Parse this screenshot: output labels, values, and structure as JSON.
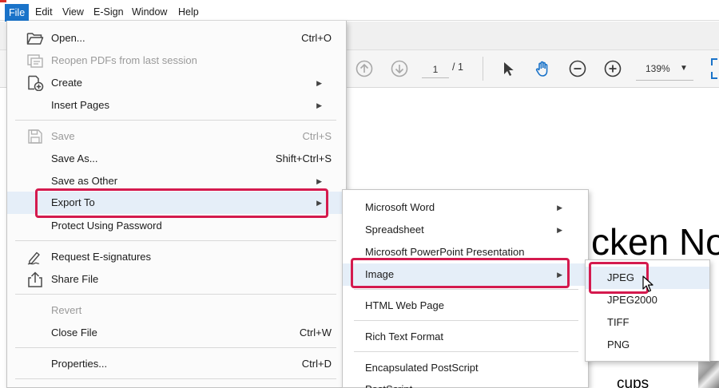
{
  "menubar": {
    "items": [
      "File",
      "Edit",
      "View",
      "E-Sign",
      "Window",
      "Help"
    ]
  },
  "toolbar": {
    "page_current": "1",
    "page_total": "/ 1",
    "zoom": "139%"
  },
  "document": {
    "heading": "cken No",
    "subheading": "cups"
  },
  "file_menu": {
    "items": [
      {
        "label": "Open...",
        "shortcut": "Ctrl+O",
        "icon": "open-folder-icon"
      },
      {
        "label": "Reopen PDFs from last session",
        "icon": "reopen-icon"
      },
      {
        "label": "Create",
        "icon": "create-icon"
      },
      {
        "label": "Insert Pages"
      },
      {
        "label": "Save",
        "shortcut": "Ctrl+S",
        "icon": "save-icon"
      },
      {
        "label": "Save As...",
        "shortcut": "Shift+Ctrl+S"
      },
      {
        "label": "Save as Other"
      },
      {
        "label": "Export To"
      },
      {
        "label": "Protect Using Password"
      },
      {
        "label": "Request E-signatures",
        "icon": "esign-pen-icon"
      },
      {
        "label": "Share File",
        "icon": "share-icon"
      },
      {
        "label": "Revert"
      },
      {
        "label": "Close File",
        "shortcut": "Ctrl+W"
      },
      {
        "label": "Properties...",
        "shortcut": "Ctrl+D"
      }
    ]
  },
  "export_menu": {
    "items": [
      {
        "label": "Microsoft Word"
      },
      {
        "label": "Spreadsheet"
      },
      {
        "label": "Microsoft PowerPoint Presentation"
      },
      {
        "label": "Image"
      },
      {
        "label": "HTML Web Page"
      },
      {
        "label": "Rich Text Format"
      },
      {
        "label": "Encapsulated PostScript"
      },
      {
        "label": "PostScript"
      }
    ]
  },
  "image_menu": {
    "items": [
      {
        "label": "JPEG"
      },
      {
        "label": "JPEG2000"
      },
      {
        "label": "TIFF"
      },
      {
        "label": "PNG"
      }
    ]
  },
  "colors": {
    "highlight_box": "#d41a4e",
    "menu_hover": "#e5eef8",
    "menubar_active": "#1a73c9",
    "toolbar_icon_blue": "#1a73c9"
  }
}
